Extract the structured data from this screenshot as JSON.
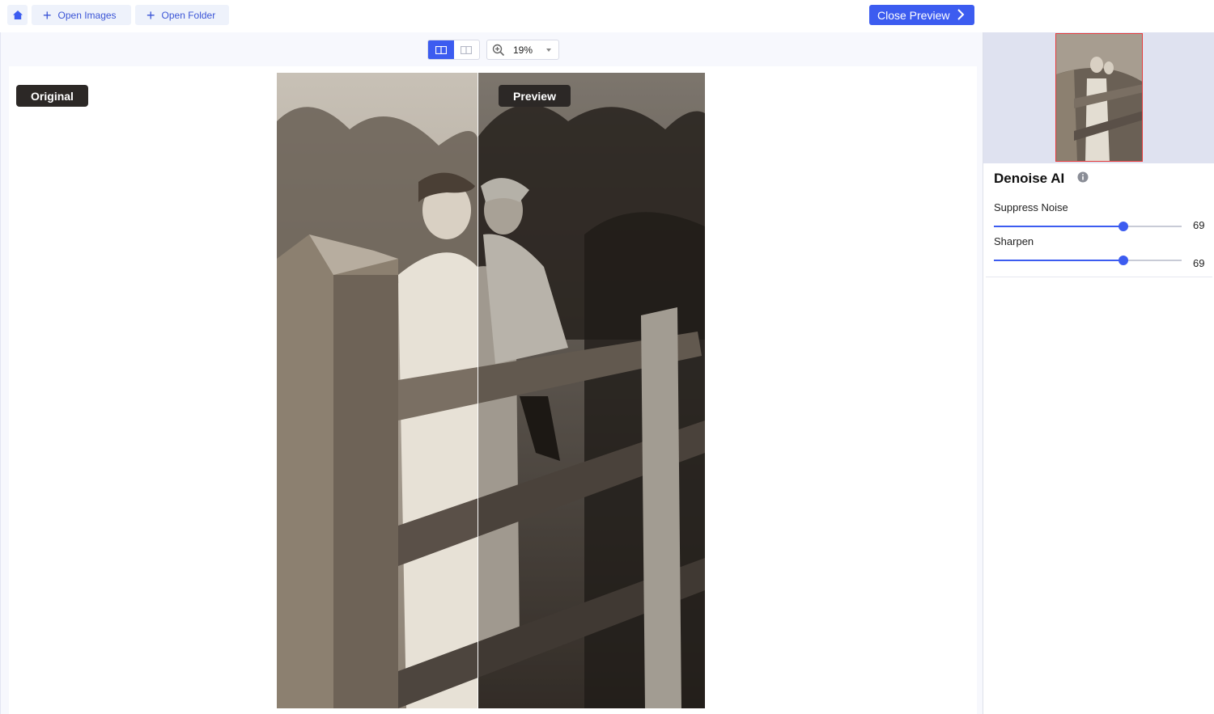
{
  "toolbar": {
    "open_images_label": "Open Images",
    "open_folder_label": "Open Folder",
    "close_preview_label": "Close Preview",
    "home_icon": "home-icon",
    "plus_glyph": "+"
  },
  "view": {
    "modes": [
      "split-view",
      "side-by-side"
    ],
    "active_mode": "split-view",
    "zoom": "19%"
  },
  "image_labels": {
    "original": "Original",
    "preview": "Preview"
  },
  "panel": {
    "title": "Denoise AI",
    "sliders": [
      {
        "label": "Suppress Noise",
        "value": "69",
        "fraction": 0.69
      },
      {
        "label": "Sharpen",
        "value": "69",
        "fraction": 0.69
      }
    ]
  },
  "colors": {
    "accent": "#3c5cf0",
    "tag_bg": "#2c2826",
    "thumb_border": "#e53b3b",
    "photo_original_tone": "#8f8171",
    "photo_preview_tone": "#3d3630"
  }
}
